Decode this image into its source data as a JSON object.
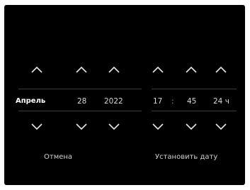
{
  "picker": {
    "month": "Апрель",
    "day": "28",
    "year": "2022",
    "hour": "17",
    "time_separator": ":",
    "minute": "45",
    "format": "24 ч"
  },
  "buttons": {
    "cancel_label": "Отмена",
    "set_date_label": "Установить дату"
  },
  "icons": {
    "up": "chevron-up-icon",
    "down": "chevron-down-icon"
  },
  "colors": {
    "background": "#000000",
    "text": "#d9d9d9",
    "selected_text": "#ffffff"
  }
}
